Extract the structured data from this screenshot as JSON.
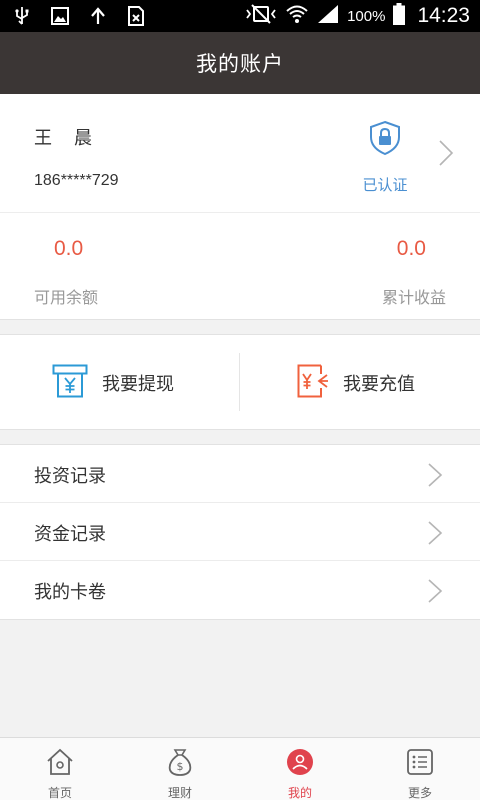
{
  "status_bar": {
    "battery_percent": "100%",
    "time": "14:23"
  },
  "header": {
    "title": "我的账户"
  },
  "account": {
    "name": "王　晨",
    "phone": "186*****729",
    "verify_status": "已认证",
    "available_balance": "0.0",
    "available_balance_label": "可用余额",
    "total_earnings": "0.0",
    "total_earnings_label": "累计收益"
  },
  "actions": {
    "withdraw_label": "我要提现",
    "recharge_label": "我要充值"
  },
  "menu": {
    "items": [
      {
        "label": "投资记录"
      },
      {
        "label": "资金记录"
      },
      {
        "label": "我的卡卷"
      }
    ]
  },
  "tabs": [
    {
      "label": "首页",
      "icon": "home-icon"
    },
    {
      "label": "理财",
      "icon": "money-bag-icon"
    },
    {
      "label": "我的",
      "icon": "user-icon",
      "active": true
    },
    {
      "label": "更多",
      "icon": "more-list-icon"
    }
  ],
  "colors": {
    "header_bg": "#3b3635",
    "accent_red": "#e0434d",
    "value_orange": "#e85a44",
    "verified_blue": "#4a8fd1",
    "withdraw_blue": "#2b9ad6",
    "recharge_orange": "#f0613d"
  }
}
